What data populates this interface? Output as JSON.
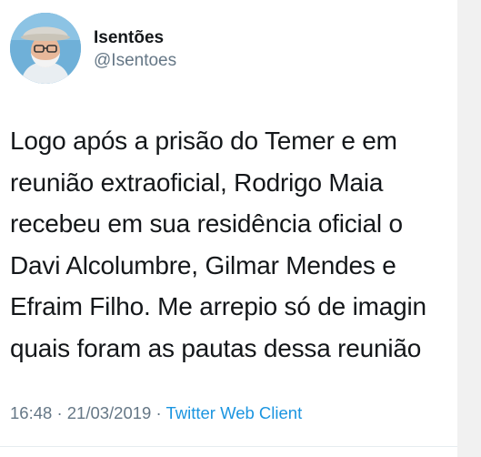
{
  "tweet": {
    "author": {
      "display_name": "Isentões",
      "handle": "@Isentoes",
      "avatar_icon": "profile-avatar"
    },
    "text_lines": [
      "Logo após a prisão do Temer e em",
      "reunião extraoficial, Rodrigo Maia",
      "recebeu em sua residência oficial o",
      "Davi Alcolumbre, Gilmar Mendes e",
      "Efraim Filho. Me arrepio só de imagin",
      "quais foram as pautas dessa reunião"
    ],
    "time": "16:48",
    "date": "21/03/2019",
    "separator": "·",
    "source": "Twitter Web Client"
  },
  "colors": {
    "text": "#14171a",
    "secondary": "#657786",
    "link": "#1b95e0"
  }
}
